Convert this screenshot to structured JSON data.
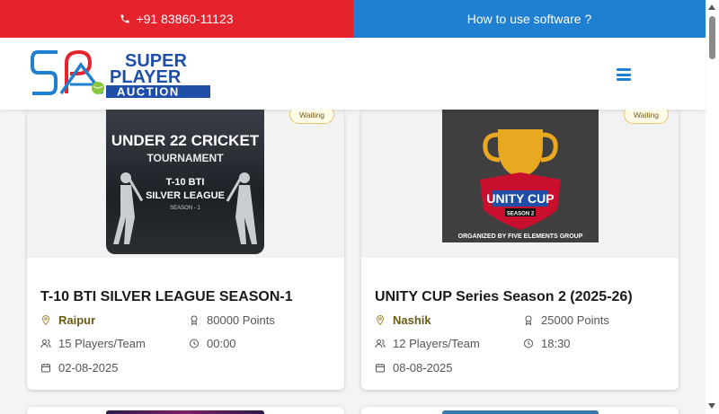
{
  "topbar": {
    "phone": "+91 83860-11123",
    "help_link": "How to use software ?"
  },
  "header": {
    "logo": {
      "line1": "SUPER",
      "line2": "PLAYER",
      "line3": "AUCTION"
    }
  },
  "cards": [
    {
      "badge": "Waiting",
      "poster": {
        "top": "UNDER 22 CRICKET",
        "mid": "TOURNAMENT",
        "l1": "T-10 BTI",
        "l2": "SILVER LEAGUE",
        "l3": "SEASON - 1"
      },
      "title": "T-10 BTI SILVER LEAGUE SEASON-1",
      "city": "Raipur",
      "points": "80000 Points",
      "players": "15 Players/Team",
      "time": "00:00",
      "date": "02-08-2025"
    },
    {
      "badge": "Waiting",
      "poster": {
        "name": "UNITY CUP",
        "season": "SEASON 2",
        "org": "ORGANIZED BY FIVE ELEMENTS GROUP"
      },
      "title": "UNITY CUP Series Season 2 (2025-26)",
      "city": "Nashik",
      "points": "25000 Points",
      "players": "12 Players/Team",
      "time": "18:30",
      "date": "08-08-2025"
    }
  ],
  "colors": {
    "red": "#e5232c",
    "blue": "#1f7fd0",
    "gold": "#6b5a12"
  }
}
